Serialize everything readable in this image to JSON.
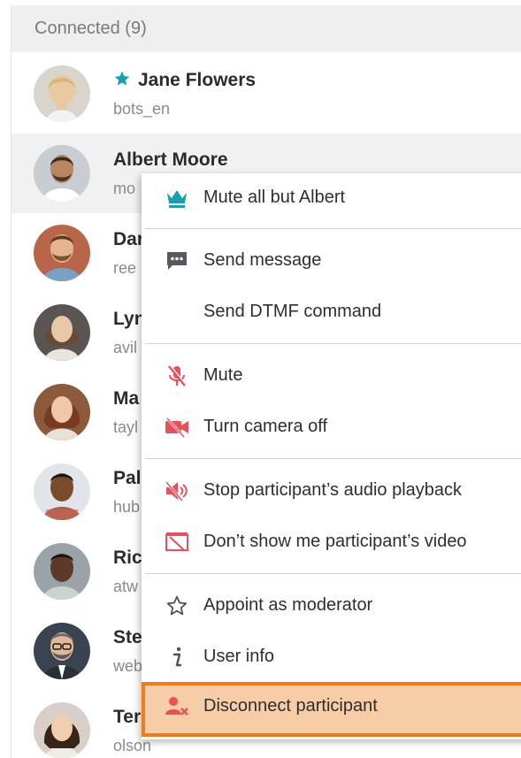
{
  "panel": {
    "header": "Connected (9)"
  },
  "participants": [
    {
      "name": "Jane Flowers",
      "sub": "bots_en",
      "moderator": true
    },
    {
      "name": "Albert Moore",
      "sub": "mo"
    },
    {
      "name": "Dar",
      "sub": "ree"
    },
    {
      "name": "Lyn",
      "sub": "avil"
    },
    {
      "name": "Ma",
      "sub": "tayl"
    },
    {
      "name": "Pal",
      "sub": "hub"
    },
    {
      "name": "Ric",
      "sub": "atw"
    },
    {
      "name": "Ste",
      "sub": "web"
    },
    {
      "name": "Ter",
      "sub": "olson"
    }
  ],
  "menu": {
    "items": [
      {
        "label": "Mute all but Albert",
        "icon": "crown-icon"
      },
      {
        "label": "Send message",
        "icon": "chat-icon"
      },
      {
        "label": "Send DTMF command",
        "icon": ""
      },
      {
        "label": "Mute",
        "icon": "mic-off-icon"
      },
      {
        "label": "Turn camera off",
        "icon": "camera-off-icon"
      },
      {
        "label": "Stop participant’s audio playback",
        "icon": "speaker-off-icon"
      },
      {
        "label": "Don’t show me participant’s video",
        "icon": "video-hidden-icon"
      },
      {
        "label": "Appoint as moderator",
        "icon": "star-outline-icon"
      },
      {
        "label": "User info",
        "icon": "info-icon"
      },
      {
        "label": "Disconnect participant",
        "icon": "disconnect-user-icon"
      }
    ]
  },
  "colors": {
    "accent": "#17a0b0",
    "danger": "#e8505b",
    "highlight_fill": "#f7cda8",
    "highlight_border": "#ef7c1c",
    "hover_row": "#f1f1f1",
    "header_bg": "#efefef"
  }
}
